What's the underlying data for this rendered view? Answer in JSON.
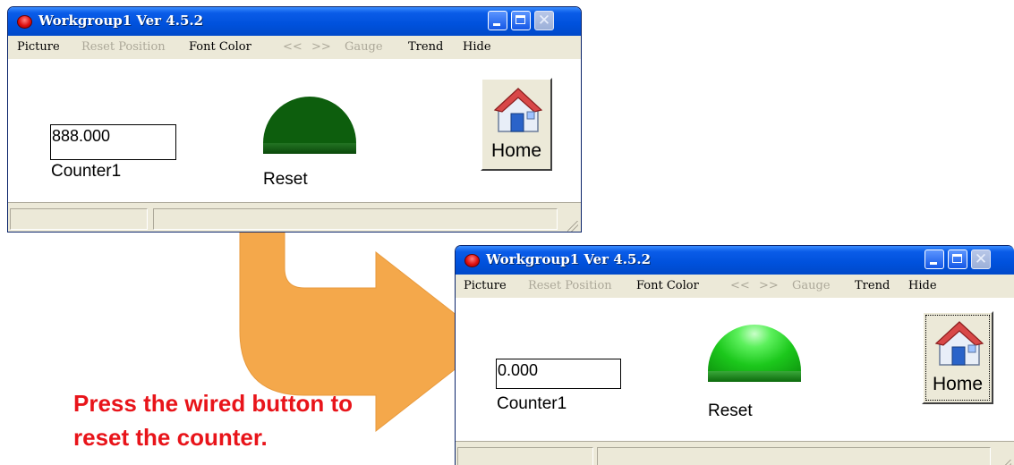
{
  "windows": [
    {
      "title": "Workgroup1 Ver 4.5.2",
      "menu": [
        "Picture",
        "Reset Position",
        "Font Color",
        "<<",
        ">>",
        "Gauge",
        "Trend",
        "Hide"
      ],
      "counter_value": "888.000",
      "counter_label": "Counter1",
      "lamp_label": "Reset",
      "lamp_state": "off",
      "home_label": "Home"
    },
    {
      "title": "Workgroup1 Ver 4.5.2",
      "menu": [
        "Picture",
        "Reset Position",
        "Font Color",
        "<<",
        ">>",
        "Gauge",
        "Trend",
        "Hide"
      ],
      "counter_value": "0.000",
      "counter_label": "Counter1",
      "lamp_label": "Reset",
      "lamp_state": "on",
      "home_label": "Home"
    }
  ],
  "caption": {
    "line1": "Press the wired button to",
    "line2": "reset the counter."
  },
  "colors": {
    "caption": "#e8141a",
    "arrow": "#f39a2c",
    "lamp_off": "#0d5e0d",
    "lamp_on": "#1cc81c",
    "titlebar": "#0051dc"
  },
  "icons": {
    "title_icon": "red-dot-icon",
    "home_icon": "house-icon",
    "arrow": "curved-arrow"
  }
}
